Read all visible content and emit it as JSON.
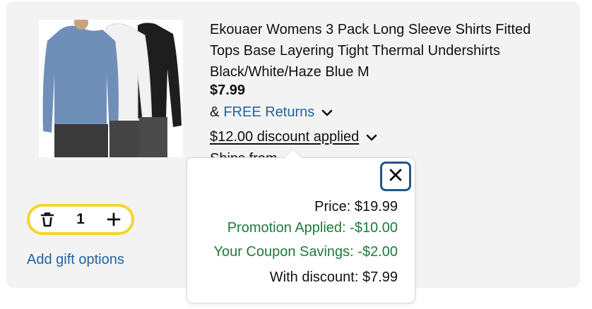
{
  "product": {
    "title_line1": "Ekouaer Womens 3 Pack Long Sleeve Shirts Fitted",
    "title_line2": "Tops Base Layering Tight Thermal Undershirts",
    "title_line3": "Black/White/Haze Blue M",
    "price": "$7.99",
    "returns_prefix": "&",
    "returns_link": "FREE Returns",
    "discount_text": "$12.00 discount applied",
    "ship_partial": "Ships from Am",
    "image_colors": [
      "#6f8fb8",
      "#f2f2f2",
      "#1f1f1f"
    ]
  },
  "cart": {
    "quantity": "1",
    "delete_icon": "trash-icon",
    "increment_icon": "plus-icon",
    "gift_options": "Add gift options"
  },
  "popover": {
    "close_icon": "close-icon",
    "price": "Price: $19.99",
    "promotion": "Promotion Applied: -$10.00",
    "coupon": "Your Coupon Savings: -$2.00",
    "with_discount": "With discount: $7.99"
  },
  "colors": {
    "link": "#2162a1",
    "savings": "#1f7a3a",
    "stepper_border": "#f7d52a",
    "focus_border": "#1f5688"
  }
}
